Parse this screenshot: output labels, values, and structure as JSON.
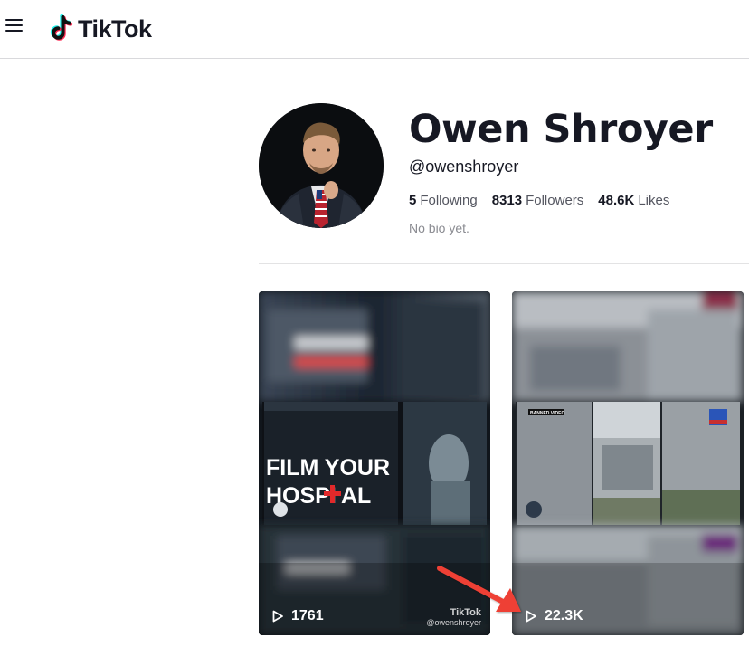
{
  "header": {
    "logo_text": "TikTok"
  },
  "profile": {
    "name": "Owen Shroyer",
    "handle": "@owenshroyer",
    "following_count": "5",
    "following_label": "Following",
    "followers_count": "8313",
    "followers_label": "Followers",
    "likes_count": "48.6K",
    "likes_label": "Likes",
    "bio": "No bio yet."
  },
  "videos": [
    {
      "views": "1761",
      "overlay_text_1": "FILM YOUR",
      "overlay_text_2": "HOSPI",
      "overlay_text_3": "AL",
      "watermark_logo": "TikTok",
      "watermark_handle": "@owenshroyer"
    },
    {
      "views": "22.3K",
      "overlay_badge": "BANNED VIDEO"
    }
  ],
  "colors": {
    "text_primary": "#161823",
    "text_secondary": "#8a8b91",
    "brand_cyan": "#25F4EE",
    "brand_red": "#FE2C55",
    "annotation_arrow": "#EE4035"
  },
  "icons": {
    "menu": "hamburger-icon",
    "logo": "tiktok-note-icon",
    "play": "play-outline-icon"
  }
}
